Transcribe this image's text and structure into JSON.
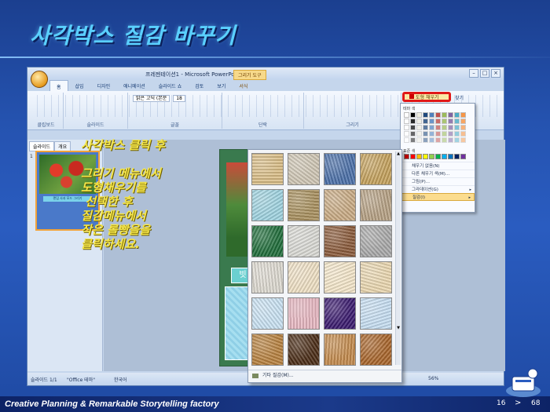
{
  "slide": {
    "title": "사각박스  질감 바꾸기",
    "instructions": "사각박스 클릭 후\n\n그리기 메뉴에서\n도형채우기를\n 선택한 후\n질감메뉴에서\n작은 롤빵을을\n클릭하세요."
  },
  "app": {
    "window_title": "프레젠테이션1 - Microsoft PowerPoint",
    "context_label": "그리기 도구",
    "tabs": [
      {
        "label": "홈",
        "active": true
      },
      {
        "label": "삽입"
      },
      {
        "label": "디자인"
      },
      {
        "label": "애니메이션"
      },
      {
        "label": "슬라이드 쇼"
      },
      {
        "label": "검토"
      },
      {
        "label": "보기"
      },
      {
        "label": "서식",
        "context": true
      }
    ],
    "groups": {
      "clipboard": "클립보드",
      "slides": "슬라이드",
      "font": "글꼴",
      "paragraph": "단락",
      "drawing": "그리기"
    },
    "ribbon_buttons": {
      "paste": "붙여넣기",
      "new_slide": "새\n슬라이드",
      "layout": "레이아웃",
      "reset": "원래대로",
      "delete": "삭제",
      "arrange": "정렬",
      "quick_styles": "빠른\n스타일",
      "find": "찾기"
    },
    "font": {
      "name": "맑은 고딕 (본문",
      "size": "18"
    },
    "shape_fill_button": "도형 채우기",
    "outline_tabs": {
      "slides": "슬라이드",
      "outline": "개요"
    },
    "thumbnail": {
      "number": "1",
      "caption": "랜덤 사과 모드 그리기"
    },
    "canvas_button_text": "빗",
    "status": {
      "slide": "슬라이드 1/1",
      "theme": "\"Office 테마\"",
      "language": "한국어",
      "zoom": "56%"
    }
  },
  "color_menu": {
    "theme_colors_label": "테마 색",
    "standard_colors_label": "표준 색",
    "theme_colors": [
      "#ffffff",
      "#000000",
      "#eeece1",
      "#1f497d",
      "#4f81bd",
      "#c0504d",
      "#9bbb59",
      "#8064a2",
      "#4bacc6",
      "#f79646"
    ],
    "standard_colors": [
      "#c00000",
      "#ff0000",
      "#ffc000",
      "#ffff00",
      "#92d050",
      "#00b050",
      "#00b0f0",
      "#0070c0",
      "#002060",
      "#7030a0"
    ],
    "items": [
      {
        "label": "채우기 없음(N)"
      },
      {
        "label": "다른 채우기 색(M)..."
      },
      {
        "label": "그림(P)..."
      },
      {
        "label": "그라데이션(G)",
        "submenu": true
      },
      {
        "label": "질감(I)",
        "submenu": true,
        "highlighted": true
      }
    ]
  },
  "texture_gallery": {
    "textures": [
      {
        "name": "Papyrus",
        "color": "#d9bd86"
      },
      {
        "name": "Canvas",
        "color": "#cfc6b4"
      },
      {
        "name": "Denim",
        "color": "#4a6fa8"
      },
      {
        "name": "Woven mat",
        "color": "#c4a15c"
      },
      {
        "name": "Water droplets",
        "color": "#9fd3e0"
      },
      {
        "name": "Recycled paper",
        "color": "#a8905e"
      },
      {
        "name": "Fish fossil",
        "color": "#c9ab84"
      },
      {
        "name": "Sand",
        "color": "#b6a184"
      },
      {
        "name": "Green marble",
        "color": "#1f6d3a"
      },
      {
        "name": "White marble",
        "color": "#d9d9d4"
      },
      {
        "name": "Brown marble",
        "color": "#8a5a3a"
      },
      {
        "name": "Granite",
        "color": "#a9a9a9"
      },
      {
        "name": "Newsprint",
        "color": "#ddd9d0"
      },
      {
        "name": "Parchment",
        "color": "#efe0c4"
      },
      {
        "name": "Stationery",
        "color": "#f4e6c9"
      },
      {
        "name": "Bouquet",
        "color": "#ead7b0"
      },
      {
        "name": "Blue tissue paper",
        "color": "#c9e2f3"
      },
      {
        "name": "Pink tissue paper",
        "color": "#e7b7c1"
      },
      {
        "name": "Purple mesh",
        "color": "#3a1a6e"
      },
      {
        "name": "Bouquet blue",
        "color": "#c6def2"
      },
      {
        "name": "Cork",
        "color": "#b7813f"
      },
      {
        "name": "Walnut",
        "color": "#4a2c16"
      },
      {
        "name": "Oak",
        "color": "#c38a4c"
      },
      {
        "name": "Medium wood",
        "color": "#a8652b"
      }
    ],
    "more_label": "기타 질감(M)..."
  },
  "footer": {
    "text": "Creative Planning & Remarkable Storytelling  factory",
    "page_current": "16",
    "arrow": ">",
    "page_total": "68"
  }
}
